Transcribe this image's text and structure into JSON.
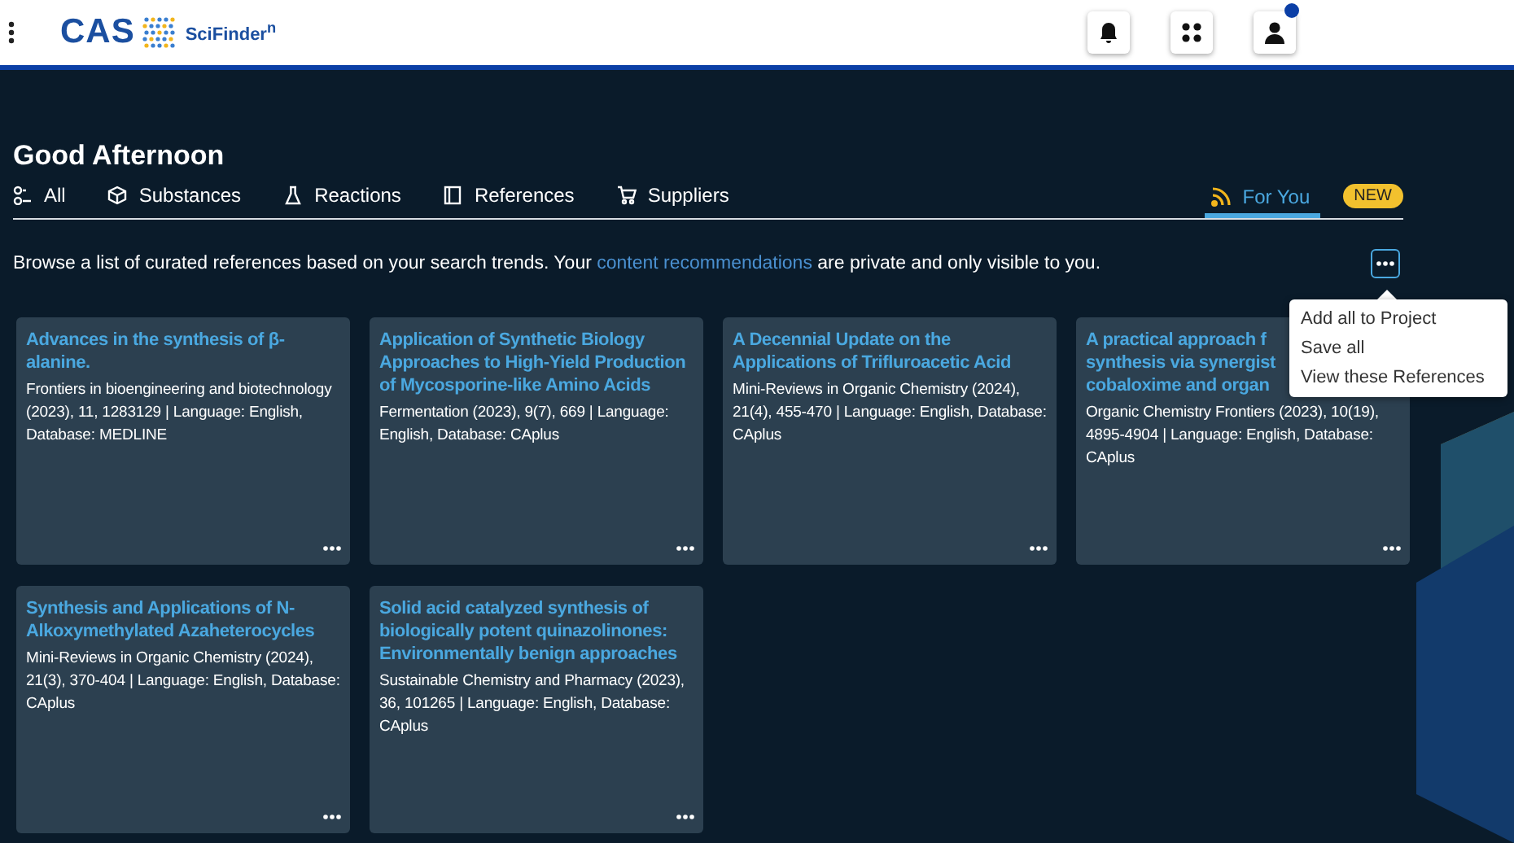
{
  "header": {
    "logo": "CAS",
    "product": "SciFinder$^{n}$",
    "notification_dot": true
  },
  "greeting": "Good Afternoon",
  "tabs": [
    {
      "label": "All",
      "selected": false
    },
    {
      "label": "Substances",
      "selected": false
    },
    {
      "label": "Reactions",
      "selected": false
    },
    {
      "label": "References",
      "selected": false
    },
    {
      "label": "Suppliers",
      "selected": false
    },
    {
      "label": "For You",
      "selected": true,
      "badge": "NEW"
    }
  ],
  "intro": {
    "before": "Browse a list of curated references based on your search trends. Your ",
    "link": "content recommendations",
    "after": " are private and only visible to you."
  },
  "menu": {
    "open": true,
    "items": [
      "Add all to Project",
      "Save all",
      "View these References"
    ]
  },
  "cards": [
    {
      "title": "Advances in the synthesis of β-\nalanine.",
      "source": "Frontiers in bioengineering and biotechnology (2023), 11, 1283129 | Language: English, Database: MEDLINE"
    },
    {
      "title": "Application of Synthetic Biology\nApproaches to High-Yield Production\nof Mycosporine-like Amino Acids",
      "source": "Fermentation (2023), 9(7), 669 | Language: English, Database: CAplus"
    },
    {
      "title": "A Decennial Update on the\nApplications of Trifluroacetic Acid",
      "source": "Mini-Reviews in Organic Chemistry (2024), 21(4), 455-470 | Language: English, Database: CAplus"
    },
    {
      "title": "A practical approach f\nsynthesis via synergist\ncobaloxime and organ",
      "source": "Organic Chemistry Frontiers (2023), 10(19), 4895-4904 | Language: English, Database: CAplus"
    },
    {
      "title": "Synthesis and Applications of N-\nAlkoxymethylated Azaheterocycles",
      "source": "Mini-Reviews in Organic Chemistry (2024), 21(3), 370-404 | Language: English, Database: CAplus"
    },
    {
      "title": "Solid acid catalyzed synthesis of\nbiologically potent quinazolinones:\nEnvironmentally benign approaches",
      "source": "Sustainable Chemistry and Pharmacy (2023), 36, 101265 | Language: English, Database: CAplus"
    }
  ]
}
